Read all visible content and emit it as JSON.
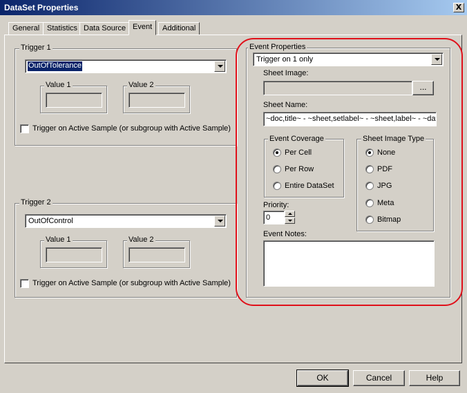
{
  "window": {
    "title": "DataSet Properties",
    "close_glyph": "X"
  },
  "tabs": [
    {
      "label": "General",
      "active": false
    },
    {
      "label": "Statistics",
      "active": false
    },
    {
      "label": "Data Source",
      "active": false
    },
    {
      "label": "Event",
      "active": true
    },
    {
      "label": "Additional",
      "active": false
    }
  ],
  "trigger1": {
    "label": "Trigger 1",
    "selected": "OutOfTolerance",
    "value1_label": "Value 1",
    "value2_label": "Value 2",
    "value1": "",
    "value2": "",
    "active_sample_label": "Trigger on Active Sample (or subgroup with Active Sample)",
    "active_sample_checked": false
  },
  "trigger2": {
    "label": "Trigger 2",
    "selected": "OutOfControl",
    "value1_label": "Value 1",
    "value2_label": "Value 2",
    "value1": "",
    "value2": "",
    "active_sample_label": "Trigger on Active Sample (or subgroup with Active Sample)",
    "active_sample_checked": false
  },
  "event_properties": {
    "label": "Event Properties",
    "trigger_mode": "Trigger on 1 only",
    "sheet_image_label": "Sheet Image:",
    "sheet_image_value": "",
    "browse_label": "...",
    "sheet_name_label": "Sheet Name:",
    "sheet_name_value": "~doc,title~ - ~sheet,setlabel~ - ~sheet,label~ - ~dat",
    "coverage": {
      "label": "Event Coverage",
      "options": [
        "Per Cell",
        "Per Row",
        "Entire DataSet"
      ],
      "selected": "Per Cell"
    },
    "image_type": {
      "label": "Sheet Image Type",
      "options": [
        "None",
        "PDF",
        "JPG",
        "Meta",
        "Bitmap"
      ],
      "selected": "None"
    },
    "priority_label": "Priority:",
    "priority_value": "0",
    "notes_label": "Event Notes:",
    "notes_value": ""
  },
  "footer": {
    "ok_label": "OK",
    "cancel_label": "Cancel",
    "help_label": "Help"
  },
  "colors": {
    "face": "#d4d0c8",
    "title_start": "#0a246a",
    "title_end": "#a6caf0",
    "selection": "#0a246a",
    "annotation_ellipse": "#e0101a"
  }
}
